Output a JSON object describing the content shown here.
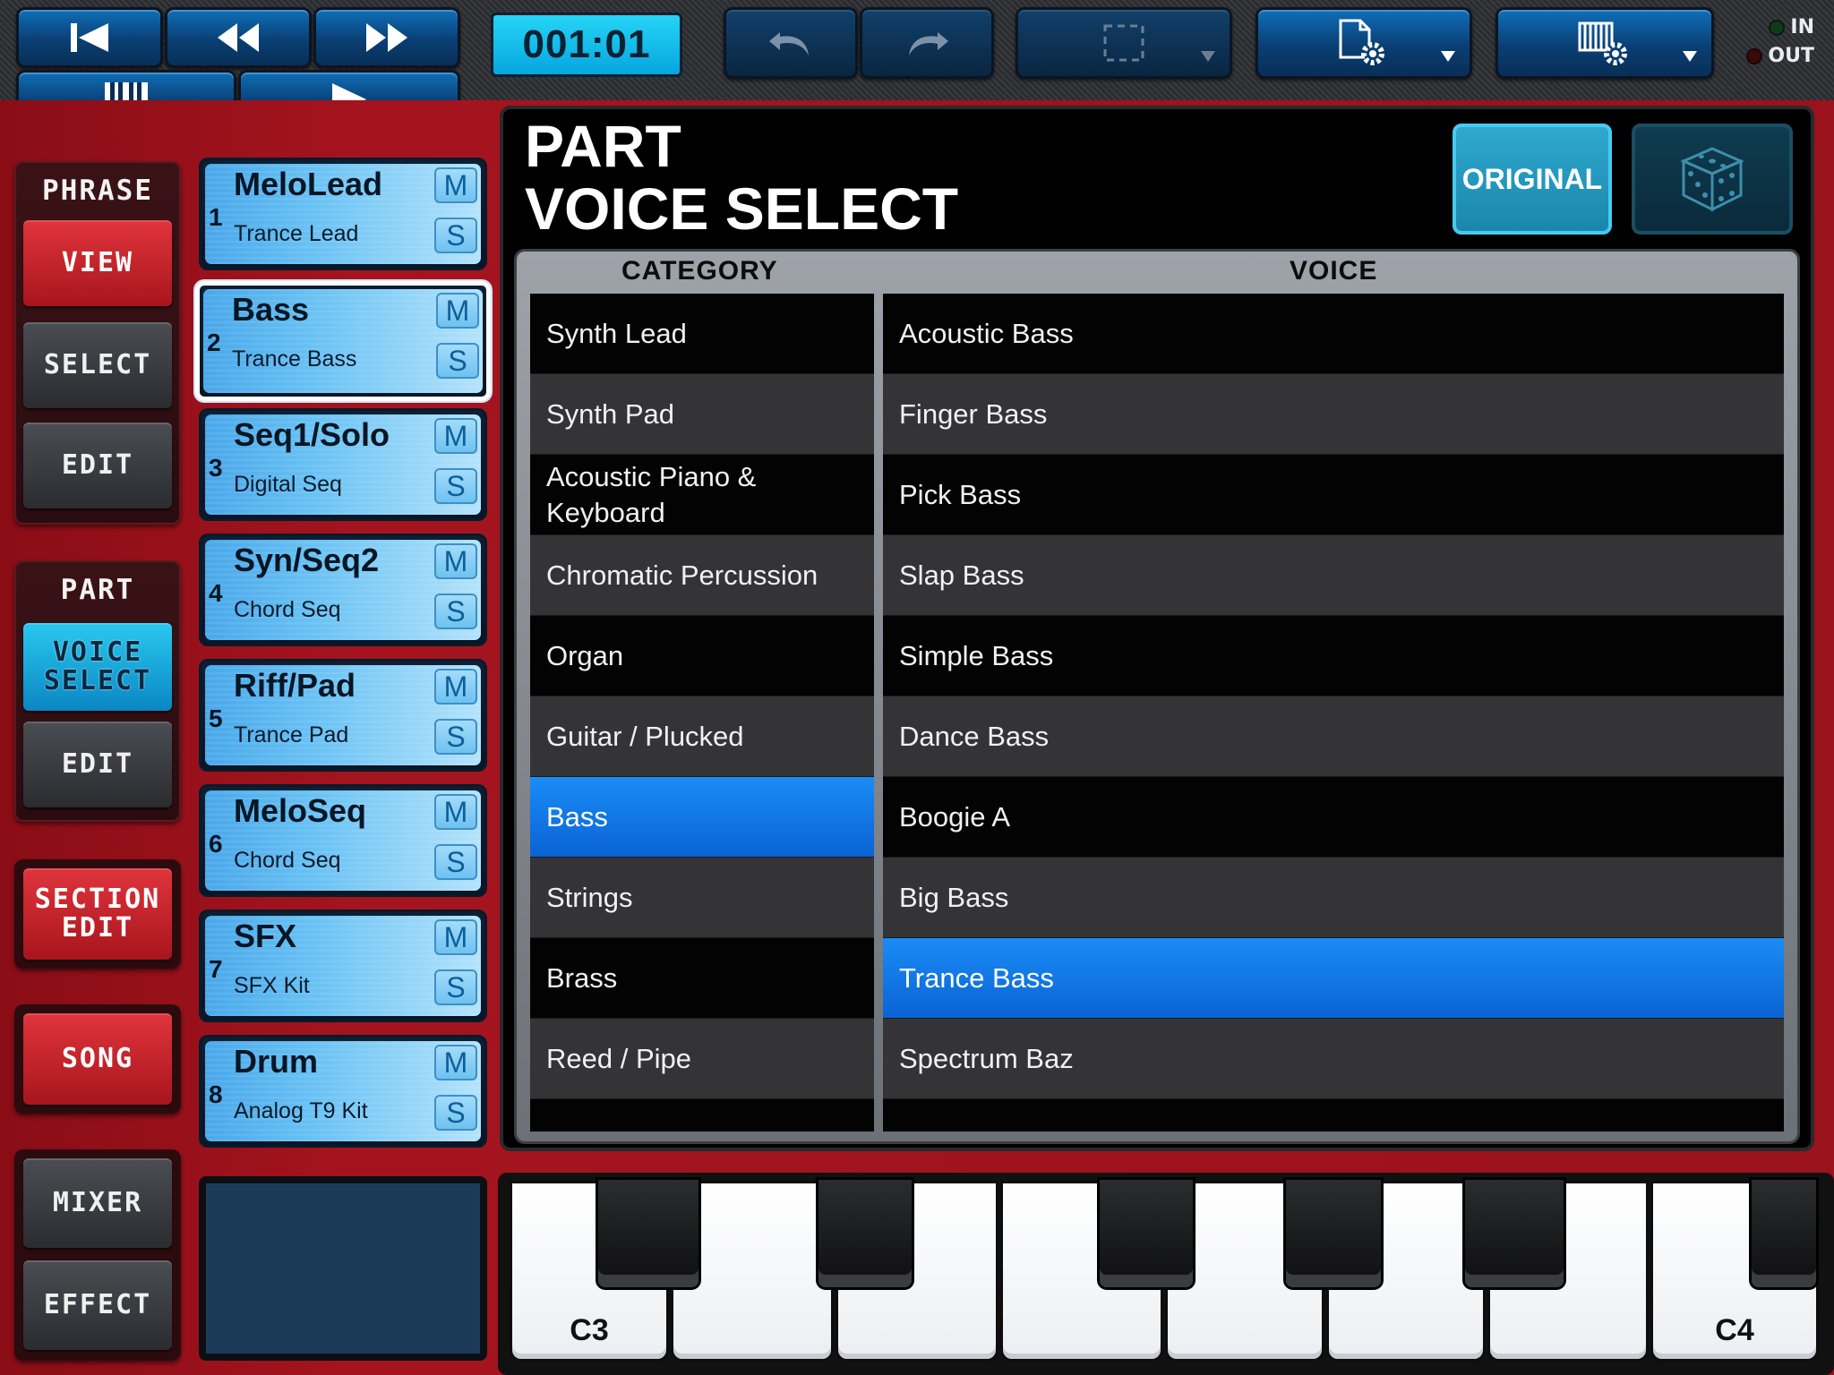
{
  "transport": {
    "counter": "001:01",
    "in_label": "IN",
    "out_label": "OUT"
  },
  "nav": {
    "phrase": {
      "header": "PHRASE",
      "view": "VIEW",
      "select": "SELECT",
      "edit": "EDIT"
    },
    "part": {
      "header": "PART",
      "voice_select": "VOICE SELECT",
      "edit": "EDIT"
    },
    "section_edit": "SECTION EDIT",
    "song": "SONG",
    "mixer": "MIXER",
    "effect": "EFFECT"
  },
  "parts": [
    {
      "num": "1",
      "name": "MeloLead",
      "voice": "Trance Lead"
    },
    {
      "num": "2",
      "name": "Bass",
      "voice": "Trance Bass"
    },
    {
      "num": "3",
      "name": "Seq1/Solo",
      "voice": "Digital Seq"
    },
    {
      "num": "4",
      "name": "Syn/Seq2",
      "voice": "Chord Seq"
    },
    {
      "num": "5",
      "name": "Riff/Pad",
      "voice": "Trance Pad"
    },
    {
      "num": "6",
      "name": "MeloSeq",
      "voice": "Chord Seq"
    },
    {
      "num": "7",
      "name": "SFX",
      "voice": "SFX Kit"
    },
    {
      "num": "8",
      "name": "Drum",
      "voice": "Analog T9 Kit"
    }
  ],
  "mute_label": "M",
  "solo_label": "S",
  "panel": {
    "title_line1": "PART",
    "title_line2": "VOICE SELECT",
    "original_label": "ORIGINAL",
    "category_header": "CATEGORY",
    "voice_header": "VOICE"
  },
  "categories": [
    "Synth Lead",
    "Synth Pad",
    "Acoustic Piano & Keyboard",
    "Chromatic Percussion",
    "Organ",
    "Guitar / Plucked",
    "Bass",
    "Strings",
    "Brass",
    "Reed / Pipe"
  ],
  "selected_category": "Bass",
  "voices": [
    "Acoustic Bass",
    "Finger Bass",
    "Pick Bass",
    "Slap Bass",
    "Simple Bass",
    "Dance Bass",
    "Boogie A",
    "Big Bass",
    "Trance Bass",
    "Spectrum Baz"
  ],
  "selected_voice": "Trance Bass",
  "keyboard": {
    "low_label": "C3",
    "high_label": "C4"
  },
  "colors": {
    "accent_blue": "#0a63d4",
    "frame_red": "#a5141e",
    "counter_cyan": "#07a6df"
  }
}
